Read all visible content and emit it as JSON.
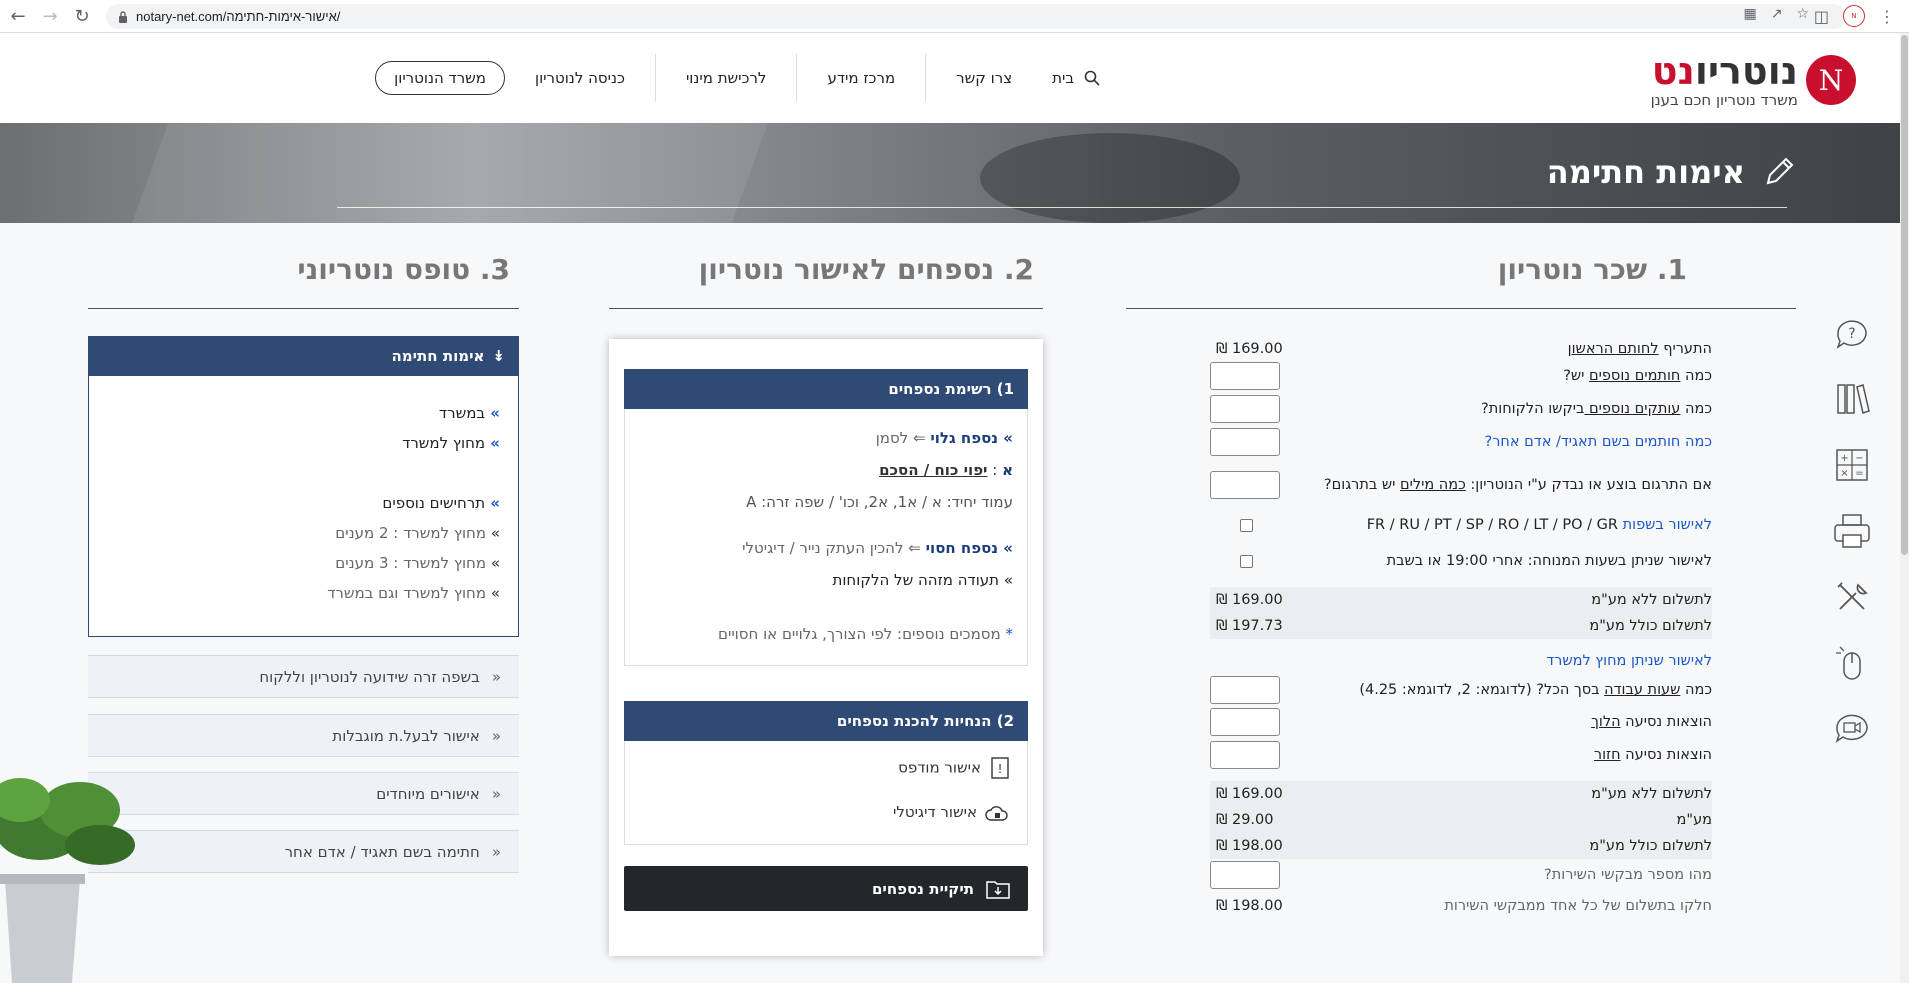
{
  "browser": {
    "url": "notary-net.com/אישור-אימות-חתימה/"
  },
  "header": {
    "logo_name_red": "נט",
    "logo_name_dark": "נוטריו",
    "logo_letter": "N",
    "logo_tagline": "משרד נוטריון חכם בענן",
    "office_button": "משרד הנוטריון",
    "menu": [
      "כניסה לנוטריון",
      "לרכישת מינוי",
      "מרכז מידע",
      "צרו קשר",
      "בית"
    ]
  },
  "banner": {
    "title": "אימות חתימה"
  },
  "fee": {
    "title": "1. שכר נוטריון",
    "rows": [
      {
        "pre": "התעריף ",
        "link": "לחותם הראשון",
        "post": "",
        "value": "169.00 ₪"
      },
      {
        "pre": "כמה ",
        "link": "חותמים נוספים",
        "post": " יש?"
      },
      {
        "pre": "כמה ",
        "link": "עותקים נוספים ",
        "post": "ביקשו הלקוחות?"
      },
      {
        "pre": "",
        "link": "",
        "post": "כמה חותמים בשם תאגיד/ אדם אחר?"
      },
      {
        "pre": "אם התרגום בוצע או נבדק ע\"י הנוטריון: ",
        "link": "כמה מילים",
        "post": " יש בתרגום?"
      },
      {
        "pre": "לאישור בשפות ",
        "link": "",
        "post": "FR / RU / PT / SP / RO / LT / PO / GR"
      },
      {
        "pre": "לאישור שניתן בשעות המנוחה: אחרי 19:00 או בשבת",
        "link": "",
        "post": ""
      },
      {
        "pre": "לתשלום ללא מע\"מ",
        "value": "169.00 ₪"
      },
      {
        "pre": "לתשלום כולל מע\"מ",
        "value": "197.73 ₪"
      },
      {
        "pre": "לאישור שניתן מחוץ למשרד"
      },
      {
        "pre": "כמה ",
        "link": "שעות עבודה",
        "post": " בסך הכל? (לדוגמא: 2, לדוגמא: 4.25)"
      },
      {
        "pre": "הוצאות נסיעה ",
        "link": "הלוך",
        "post": ""
      },
      {
        "pre": "הוצאות נסיעה ",
        "link": "חזור",
        "post": ""
      },
      {
        "pre": "לתשלום ללא מע\"מ",
        "value": "169.00 ₪"
      },
      {
        "pre": "מע\"מ",
        "value": "29.00 ₪"
      },
      {
        "pre": "לתשלום כולל מע\"מ",
        "value": "198.00 ₪"
      },
      {
        "pre": "מהו מספר מבקשי השירות?"
      },
      {
        "pre": "חלקו בתשלום של כל אחד ממבקשי השירות",
        "value": "198.00 ₪"
      }
    ]
  },
  "appendix": {
    "title": "2. נספחים לאישור נוטריון",
    "list_header": "1) רשימת נספחים",
    "visible_label": "» נספח גלוי",
    "visible_text": " ⇐ לסמן",
    "letter_a": "א",
    "letter_a_sep": " : ",
    "letter_a_text": "יפוי כוח / הסכם",
    "page_line": "עמוד יחיד: א  /  א1, א2, וכו' / שפה זרה: A",
    "hidden_label": "» נספח חסוי",
    "hidden_text": " ⇐ להכין העתק נייר / דיגיטלי",
    "id_doc": "» תעודה מזהה של הלקוחות",
    "asterisk": "* ",
    "more_docs": "מסמכים נוספים: לפי הצורך, גלויים או חסויים",
    "instructions_header": "2) הנחיות להכנת נספחים",
    "printed": "אישור מודפס",
    "digital": "אישור דיגיטלי",
    "download": "תיקיית נספחים"
  },
  "form": {
    "title": "3. טופס נוטריוני",
    "active_header": "אימות חתימה",
    "items": [
      {
        "ch": "» ",
        "text": "במשרד"
      },
      {
        "ch": "» ",
        "text": "מחוץ למשרד"
      },
      {
        "ch": "» ",
        "text": "תרחישים נוספים"
      },
      {
        "ch": "» ",
        "text": "מחוץ למשרד : 2 מענים"
      },
      {
        "ch": "» ",
        "text": "מחוץ למשרד : 3 מענים"
      },
      {
        "ch": "» ",
        "text": "מחוץ למשרד וגם במשרד"
      }
    ],
    "folds": [
      "בשפה זרה שידועה לנוטריון וללקוח",
      "אישור לבעל.ת מוגבלות",
      "אישורים מיוחדים",
      "חתימה בשם תאגיד / אדם אחר"
    ]
  },
  "colors": {
    "brand": "#c8102e",
    "navy": "#2f4a74",
    "link": "#1a56c9"
  }
}
